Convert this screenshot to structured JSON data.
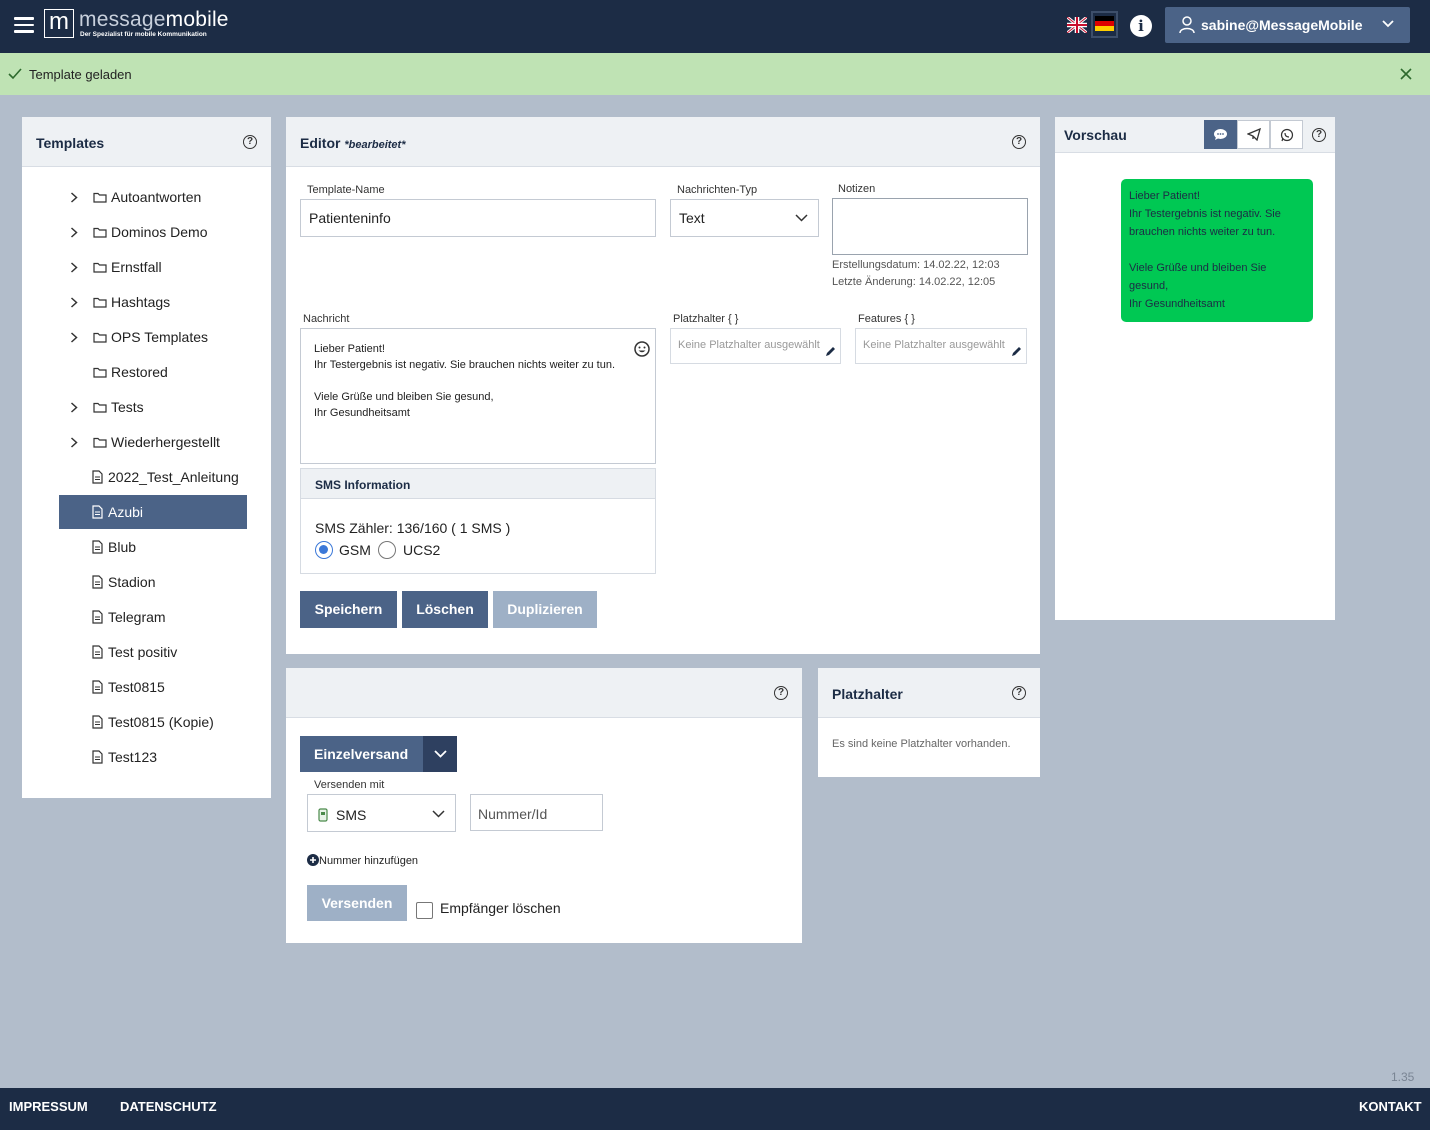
{
  "header": {
    "logo_letter": "m",
    "logo_name_part1": "message",
    "logo_name_part2": "mobile",
    "logo_tagline": "Der Spezialist für mobile Kommunikation",
    "user": "sabine@MessageMobile"
  },
  "notification": {
    "message": "Template geladen"
  },
  "templates_panel": {
    "title": "Templates",
    "folders": [
      "Autoantworten",
      "Dominos Demo",
      "Ernstfall",
      "Hashtags",
      "OPS Templates",
      "Restored",
      "Tests",
      "Wiederhergestellt"
    ],
    "files": [
      "2022_Test_Anleitung",
      "Azubi",
      "Blub",
      "Stadion",
      "Telegram",
      "Test positiv",
      "Test0815",
      "Test0815 (Kopie)",
      "Test123"
    ],
    "active_file": "Azubi"
  },
  "editor": {
    "title": "Editor",
    "status": "*bearbeitet*",
    "template_name_label": "Template-Name",
    "template_name_value": "Patienteninfo",
    "message_type_label": "Nachrichten-Typ",
    "message_type_value": "Text",
    "notes_label": "Notizen",
    "created": "Erstellungsdatum: 14.02.22, 12:03",
    "modified": "Letzte Änderung: 14.02.22, 12:05",
    "message_label": "Nachricht",
    "message_lines": [
      "Lieber Patient!",
      "Ihr Testergebnis ist negativ. Sie brauchen nichts weiter zu tun.",
      "",
      "Viele Grüße und bleiben Sie gesund,",
      "Ihr Gesundheitsamt"
    ],
    "placeholder_label": "Platzhalter { }",
    "placeholder_value": "Keine Platzhalter ausgewählt",
    "features_label": "Features { }",
    "features_value": "Keine Platzhalter ausgewählt",
    "sms_info_title": "SMS Information",
    "sms_counter": "SMS Zähler: 136/160 ( 1 SMS )",
    "encoding_options": [
      "GSM",
      "UCS2"
    ],
    "encoding_selected": "GSM",
    "save_label": "Speichern",
    "delete_label": "Löschen",
    "duplicate_label": "Duplizieren"
  },
  "preview": {
    "title": "Vorschau",
    "bubble_lines": [
      "Lieber Patient!",
      "Ihr Testergebnis ist negativ. Sie",
      "brauchen nichts weiter zu tun.",
      "",
      "Viele Grüße und bleiben Sie",
      "gesund,",
      "Ihr Gesundheitsamt"
    ],
    "bubble_color": "#00c853"
  },
  "send_panel": {
    "mode_label": "Einzelversand",
    "send_with_label": "Versenden mit",
    "channel_value": "SMS",
    "number_placeholder": "Nummer/Id",
    "add_number_label": "Nummer hinzufügen",
    "send_label": "Versenden",
    "clear_recipients_label": "Empfänger löschen"
  },
  "placeholder_panel": {
    "title": "Platzhalter",
    "empty_text": "Es sind keine Platzhalter vorhanden."
  },
  "version": "1.35",
  "footer": {
    "imprint": "IMPRESSUM",
    "privacy": "DATENSCHUTZ",
    "contact": "KONTAKT"
  },
  "colors": {
    "topbar": "#1c2c45",
    "accent": "#4b6387",
    "notification_bg": "#bfe3b4",
    "page_bg": "#b2bdcb"
  }
}
